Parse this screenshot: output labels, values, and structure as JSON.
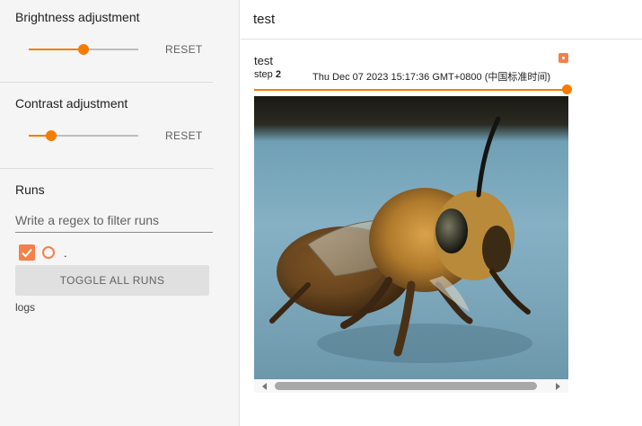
{
  "sidebar": {
    "brightness": {
      "title": "Brightness adjustment",
      "reset_label": "RESET",
      "value_fraction": 0.5
    },
    "contrast": {
      "title": "Contrast adjustment",
      "reset_label": "RESET",
      "value_fraction": 0.2
    },
    "runs": {
      "title": "Runs",
      "filter_placeholder": "Write a regex to filter runs",
      "filter_value": "",
      "items": [
        {
          "name": ".",
          "checked": true,
          "color": "#f4804a"
        }
      ],
      "toggle_all_label": "TOGGLE ALL RUNS",
      "logdir_label": "logs"
    }
  },
  "main": {
    "tag_title": "test",
    "card": {
      "title": "test",
      "step_label": "step",
      "step_value": "2",
      "timestamp": "Thu Dec 07 2023 15:17:36 GMT+0800 (中国标准时间)",
      "step_slider_fraction": 1.0
    }
  },
  "colors": {
    "accent": "#f57c00",
    "run_color": "#f4804a",
    "sidebar_bg": "#f5f5f5"
  },
  "icons": {
    "checkbox": "check-icon",
    "run_color": "circle-outline-icon",
    "expand": "expand-icon",
    "scroll_left": "chevron-left-icon",
    "scroll_right": "chevron-right-icon"
  }
}
